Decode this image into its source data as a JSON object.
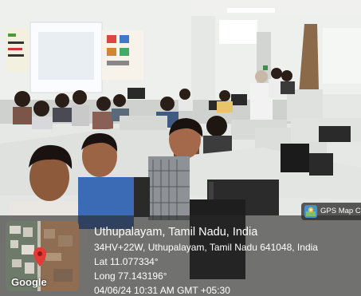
{
  "scene": {
    "description_icon": "photo-of-computer-lab-with-students"
  },
  "gps_badge": {
    "label": "GPS Map Ca",
    "icon": "gps-map-camera-icon"
  },
  "map": {
    "provider_label": "Google",
    "pin_icon": "map-pin-icon"
  },
  "location": {
    "place": "Uthupalayam, Tamil Nadu, India",
    "address": "34HV+22W, Uthupalayam, Tamil Nadu 641048, India",
    "latitude": "Lat 11.077334°",
    "longitude": "Long 77.143196°",
    "datetime": "04/06/24 10:31 AM GMT +05:30"
  },
  "colors": {
    "wall": "#e9ebe8",
    "cubicle": "#dcdedd",
    "overlay": "#2f2f2f",
    "pin": "#e53935"
  }
}
